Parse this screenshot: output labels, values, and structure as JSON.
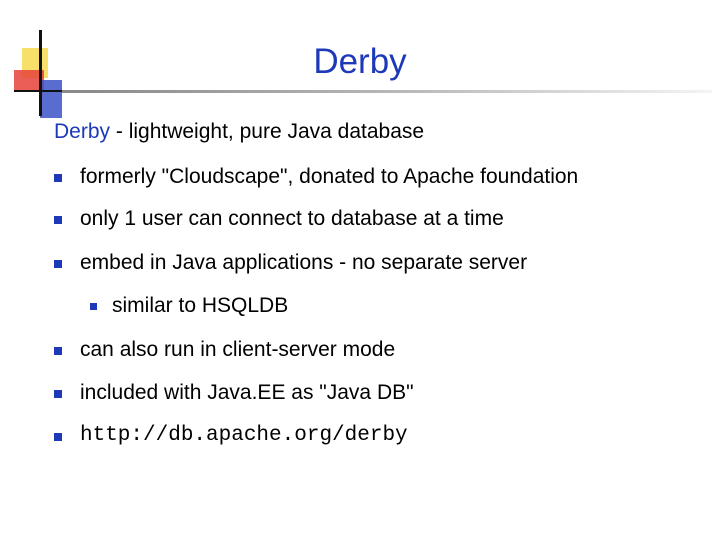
{
  "slide": {
    "title": "Derby",
    "intro": {
      "term": "Derby",
      "rest": " - lightweight, pure Java database"
    },
    "bullets": [
      "formerly \"Cloudscape\", donated to Apache foundation",
      "only 1 user can connect to database at a time",
      "embed in Java applications - no separate server",
      "similar to HSQLDB",
      "can also run in client-server mode",
      "included with Java.EE as \"Java DB\"",
      "http://db.apache.org/derby"
    ]
  },
  "colors": {
    "accent": "#1d39b8",
    "text": "#000000",
    "background": "#ffffff"
  }
}
